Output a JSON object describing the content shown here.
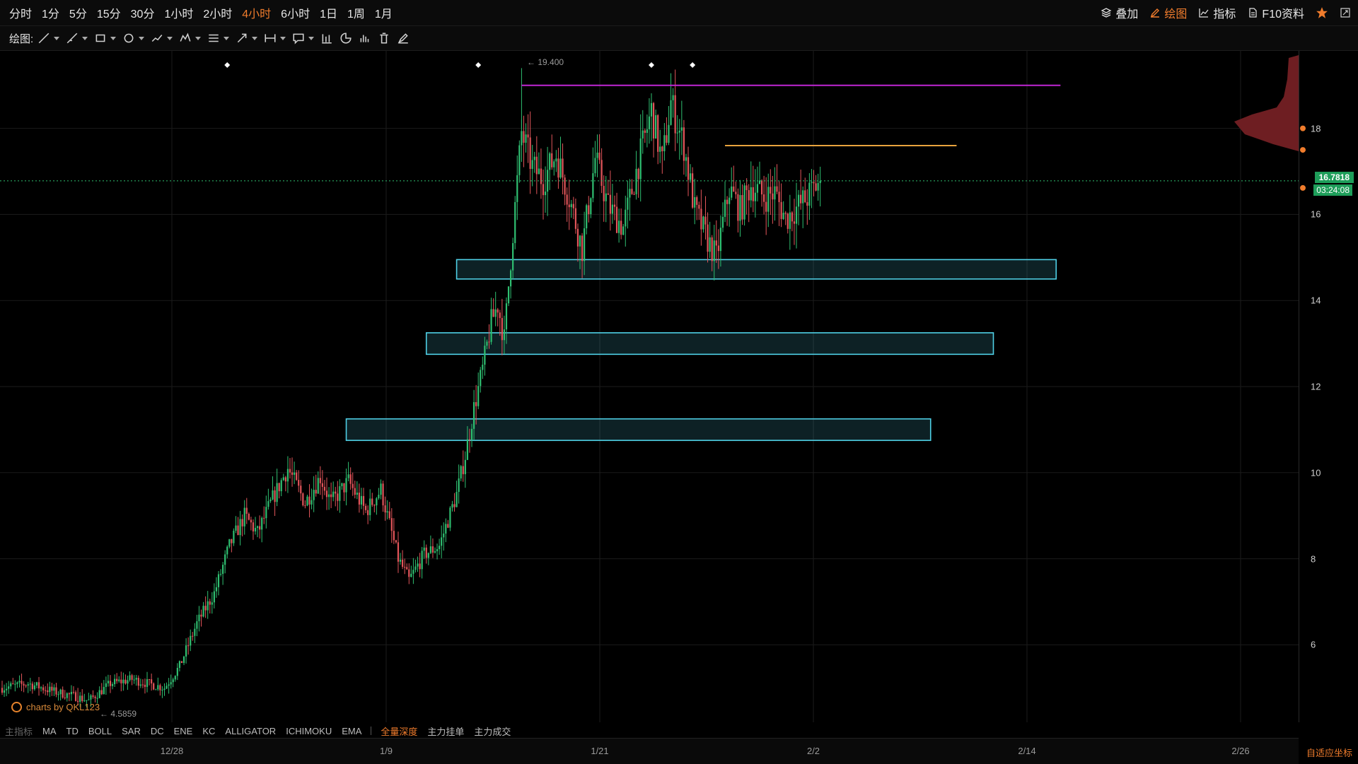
{
  "timeframes": [
    "分时",
    "1分",
    "5分",
    "15分",
    "30分",
    "1小时",
    "2小时",
    "4小时",
    "6小时",
    "1日",
    "1周",
    "1月"
  ],
  "active_timeframe": "4小时",
  "top_right": {
    "overlay_label": "叠加",
    "draw_label": "绘图",
    "indicator_label": "指标",
    "f10_label": "F10资料"
  },
  "drawbar": {
    "label": "绘图:",
    "tools": [
      "trendline-icon",
      "ray-icon",
      "rectangle-icon",
      "ellipse-icon",
      "fib-icon",
      "pattern-icon",
      "channel-icon",
      "arrow-icon",
      "measure-icon",
      "note-icon",
      "bar-stats-icon",
      "pie-icon",
      "histogram-icon",
      "delete-icon",
      "pen-icon"
    ]
  },
  "indicators": {
    "main_label": "主指标",
    "items": [
      "MA",
      "TD",
      "BOLL",
      "SAR",
      "DC",
      "ENE",
      "KC",
      "ALLIGATOR",
      "ICHIMOKU",
      "EMA"
    ],
    "depth": [
      "全量深度",
      "主力挂单",
      "主力成交"
    ],
    "active_depth": "全量深度"
  },
  "autoscale_label": "自适应坐标",
  "brand": "charts by QKL123",
  "colors": {
    "up": "#2fbf71",
    "down": "#e2555a",
    "accent": "#f07c2c",
    "zone": "#4fd0e6",
    "resist1": "#c026d3",
    "resist2": "#e8a33d"
  },
  "chart_data": {
    "type": "candlestick",
    "title": "",
    "x_ticks": [
      "12/28",
      "1/9",
      "1/21",
      "2/2",
      "2/14",
      "2/26"
    ],
    "y_ticks": [
      6,
      8,
      10,
      12,
      14,
      16,
      18
    ],
    "ylim": [
      4.2,
      19.8
    ],
    "last_price": "16.7818",
    "countdown": "03:24:08",
    "high_label": "← 19.400",
    "low_label": "← 4.5859",
    "anchors": [
      [
        0,
        5.0
      ],
      [
        12,
        5.1
      ],
      [
        25,
        4.9
      ],
      [
        34,
        4.8
      ],
      [
        40,
        4.7
      ],
      [
        50,
        5.1
      ],
      [
        60,
        5.2
      ],
      [
        75,
        5.0
      ],
      [
        82,
        5.5
      ],
      [
        90,
        6.5
      ],
      [
        98,
        7.2
      ],
      [
        105,
        8.3
      ],
      [
        112,
        9.0
      ],
      [
        118,
        8.6
      ],
      [
        125,
        9.4
      ],
      [
        132,
        10.1
      ],
      [
        140,
        9.3
      ],
      [
        147,
        9.9
      ],
      [
        152,
        9.3
      ],
      [
        160,
        9.8
      ],
      [
        168,
        9.1
      ],
      [
        175,
        9.6
      ],
      [
        183,
        8.0
      ],
      [
        188,
        7.5
      ],
      [
        195,
        8.1
      ],
      [
        202,
        8.3
      ],
      [
        210,
        9.5
      ],
      [
        214,
        10.4
      ],
      [
        218,
        11.5
      ],
      [
        222,
        12.4
      ],
      [
        226,
        13.5
      ],
      [
        229,
        13.9
      ],
      [
        232,
        13.1
      ],
      [
        236,
        15.6
      ],
      [
        240,
        17.9
      ],
      [
        245,
        17.1
      ],
      [
        250,
        16.8
      ],
      [
        256,
        17.4
      ],
      [
        262,
        16.4
      ],
      [
        268,
        15.2
      ],
      [
        274,
        17.3
      ],
      [
        280,
        16.2
      ],
      [
        287,
        15.7
      ],
      [
        293,
        17.0
      ],
      [
        300,
        18.4
      ],
      [
        305,
        17.2
      ],
      [
        309,
        18.6
      ],
      [
        315,
        17.6
      ],
      [
        320,
        16.1
      ],
      [
        326,
        15.4
      ],
      [
        330,
        15.0
      ],
      [
        336,
        16.6
      ],
      [
        341,
        16.1
      ],
      [
        346,
        16.7
      ],
      [
        352,
        16.4
      ],
      [
        357,
        16.5
      ],
      [
        362,
        15.9
      ],
      [
        368,
        16.2
      ],
      [
        372,
        16.4
      ],
      [
        378,
        16.8
      ]
    ],
    "zones": [
      {
        "from": 210,
        "to": 487,
        "low": 14.5,
        "high": 14.95
      },
      {
        "from": 196,
        "to": 458,
        "low": 12.75,
        "high": 13.25
      },
      {
        "from": 159,
        "to": 429,
        "low": 10.75,
        "high": 11.25
      }
    ],
    "resistance": [
      {
        "from": 240,
        "to": 489,
        "price": 19.0
      },
      {
        "from": 334,
        "to": 441,
        "price": 17.6
      }
    ],
    "markers": [
      104,
      220,
      300,
      319
    ]
  }
}
